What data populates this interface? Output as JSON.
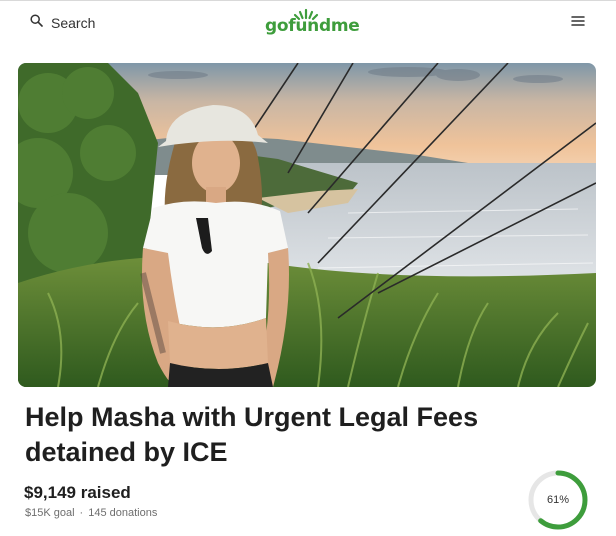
{
  "header": {
    "search_label": "Search",
    "logo_text": "gofundme",
    "brand_color": "#3e9d3c"
  },
  "hero": {
    "alt": "Photo of woman in white bucket hat and white crop top on a coastal hillside"
  },
  "campaign": {
    "title": "Help Masha with Urgent Legal Fees detained by ICE",
    "raised": "$9,149 raised",
    "goal": "$15K goal",
    "separator": "·",
    "donations": "145 donations",
    "progress_percent": 61,
    "progress_label": "61%"
  },
  "icons": [
    "search-icon",
    "gofundme-logo",
    "hamburger-menu-icon",
    "progress-ring"
  ]
}
